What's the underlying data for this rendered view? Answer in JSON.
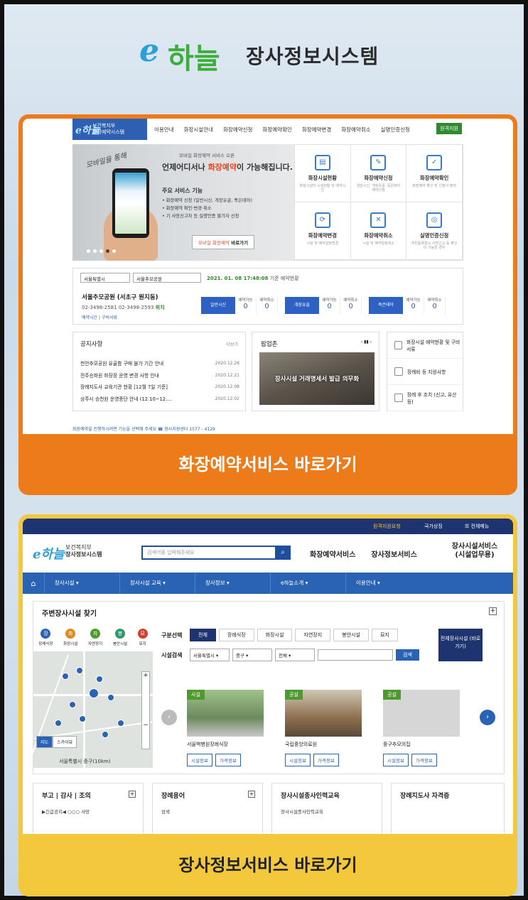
{
  "header": {
    "logo_e": "e",
    "logo_haneul": "하늘",
    "title": "장사정보시스템"
  },
  "card1": {
    "cta": "화장예약서비스 바로가기",
    "logo": {
      "ministry": "보건복지부",
      "system": "화장예약시스템"
    },
    "nav": [
      "이용안내",
      "화장시설안내",
      "화장예약신청",
      "화장예약확인",
      "화장예약변경",
      "화장예약취소",
      "실명인증신청"
    ],
    "remote": "원격지원",
    "banner": {
      "script": "모바일을 통해",
      "mobile": "모바일 화장예약 서비스 오픈",
      "headline_pre": "언제어디서나 ",
      "headline_hl": "화장예약",
      "headline_post": "이 가능해집니다.",
      "services_title": "주요 서비스 기능",
      "services": [
        "• 화장예약 신청 (일반시신, 개장유골, 죽은태아)",
        "• 화장예약 확인·변경·취소",
        "• 기 사망신고자 등 실명인증 불가자 신청"
      ],
      "button_hl": "모바일 화장예약",
      "button": " 바로가기"
    },
    "tiles": [
      {
        "title": "화장시설현황",
        "desc": "화장시설의 시설현황 및 예약시간"
      },
      {
        "title": "화장예약신청",
        "desc": "일반시신, 개장유골, 죽은태아 예약신청"
      },
      {
        "title": "화장예약확인",
        "desc": "화장예약 확인 및 신청서 출력"
      },
      {
        "title": "화장예약변경",
        "desc": "시설 및 예약일정변경"
      },
      {
        "title": "화장예약취소",
        "desc": "시설 및 예약일정취소"
      },
      {
        "title": "실명인증신청",
        "desc": "주민등록말소 사망신고 등 확인이 가능한 경우"
      }
    ],
    "status": {
      "region": "서울특별시",
      "facility": "서울추모공원",
      "date": "2021. 01. 08 17:48:08",
      "date_suffix": " 기준 예약현황",
      "place": "서울추모공원 (서초구 원지동)",
      "tel": "02-3498-2581   02-3498-2593",
      "location": "위치",
      "links": "예약시간  |  구비서류",
      "groups": [
        {
          "label": "일반시신",
          "c1": "예약가능",
          "v1": "0",
          "c2": "예약취소",
          "v2": "0"
        },
        {
          "label": "개장유골",
          "c1": "예약가능",
          "v1": "0",
          "c2": "예약취소",
          "v2": "0"
        },
        {
          "label": "죽은태아",
          "c1": "예약가능",
          "v1": "0",
          "c2": "예약취소",
          "v2": "0"
        }
      ]
    },
    "notice": {
      "title": "공지사항",
      "more": "더보기",
      "items": [
        {
          "text": "천안추모공원 유골함 구매 불가 기간 안내",
          "date": "2020.12.28"
        },
        {
          "text": "전주승화원 화장장 운영 변경 사항 안내",
          "date": "2020.12.21"
        },
        {
          "text": "장례지도사 교육기관 현황 [12월 7일 기준]",
          "date": "2020.12.08"
        },
        {
          "text": "상주시 승천원 운영중단 안내 (12.10~12....",
          "date": "2020.12.02"
        }
      ]
    },
    "popup": {
      "title": "팝업존",
      "image_text": "장사시설 거래명세서 발급 의무화"
    },
    "quick": [
      "화장시설 예약현황 및 구비서류",
      "장례비 등 지원사항",
      "장례 후 조치 (신고, 유산 등)"
    ],
    "footer": "화장예약을 진행하시려면 기능을 선택해 주세요    ☎ 장사지원센터  1577 - 4129"
  },
  "card2": {
    "cta": "장사정보서비스 바로가기",
    "util": {
      "remote": "원격지원요청",
      "national": "국가상징",
      "all_menu": "전체메뉴"
    },
    "logo": {
      "e": "e하늘",
      "ministry": "보건복지부",
      "system": "장사정보시스템"
    },
    "search_placeholder": "검색어를 입력해주세요",
    "main_nav": [
      "화장예약서비스",
      "장사정보서비스"
    ],
    "main_nav_last": "장사시설서비스\n(시설업무용)",
    "gnb": [
      "장사시설",
      "장사시설 교육",
      "장사정보",
      "e하늘소개",
      "이용안내"
    ],
    "find": {
      "title": "주변장사시설 찾기",
      "cats": [
        {
          "mark": "장",
          "label": "장례식장",
          "color": "#2a63b3"
        },
        {
          "mark": "화",
          "label": "화장시설",
          "color": "#e08a1e"
        },
        {
          "mark": "자",
          "label": "자연장지",
          "color": "#4d9a2e"
        },
        {
          "mark": "봉",
          "label": "봉안시설",
          "color": "#2a9a6e"
        },
        {
          "mark": "묘",
          "label": "묘지",
          "color": "#d0402a"
        }
      ],
      "map_label": "서울특별시 중구(10km)",
      "map_toggle": [
        "지도",
        "스카이뷰"
      ],
      "cond_label": "구분선택",
      "cond_tabs": [
        "전체",
        "장례식장",
        "화장시설",
        "자연장지",
        "봉안시설",
        "묘지"
      ],
      "search_label": "시설검색",
      "selects": [
        "서울특별시",
        "중구",
        "전체"
      ],
      "search_btn": "검색",
      "all_btn": "전체장사시설 (바로가기)",
      "facilities": [
        {
          "tag": "사설",
          "name": "서울백병원장례식장"
        },
        {
          "tag": "공설",
          "name": "국립중앙의료원"
        },
        {
          "tag": "공설",
          "name": "중구추모의집"
        }
      ],
      "info_btn": "시설정보",
      "price_btn": "가격정보"
    },
    "bottom": [
      {
        "title": "부고 | 감사 | 조의",
        "sub": "▶긴급공지◀  ○○○ 사망"
      },
      {
        "title": "장례용어",
        "sub": "검색"
      },
      {
        "title": "장사시설종사인력교육",
        "sub": "장사시설종사인력교육"
      },
      {
        "title": "장례지도사 자격증",
        "sub": ""
      }
    ]
  }
}
